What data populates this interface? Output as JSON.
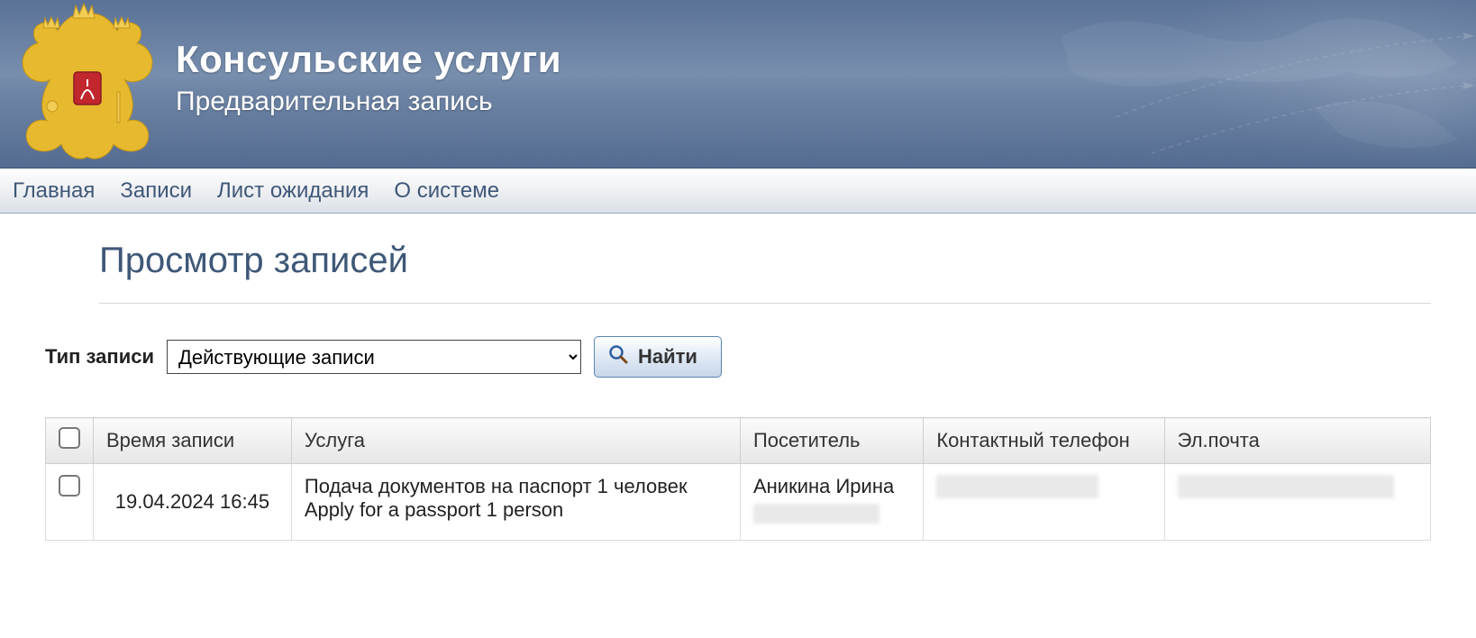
{
  "banner": {
    "title": "Консульские услуги",
    "subtitle": "Предварительная запись"
  },
  "nav": {
    "home": "Главная",
    "records": "Записи",
    "waiting": "Лист ожидания",
    "about": "О системе"
  },
  "page": {
    "title": "Просмотр записей"
  },
  "filter": {
    "label": "Тип записи",
    "selected": "Действующие записи",
    "find_label": "Найти"
  },
  "table": {
    "columns": {
      "time": "Время записи",
      "service": "Услуга",
      "visitor": "Посетитель",
      "phone": "Контактный телефон",
      "email": "Эл.почта"
    },
    "rows": [
      {
        "time": "19.04.2024 16:45",
        "service_ru": "Подача документов на паспорт 1 человек",
        "service_en": "Apply for a passport 1 person",
        "visitor": "Аникина Ирина"
      }
    ]
  }
}
